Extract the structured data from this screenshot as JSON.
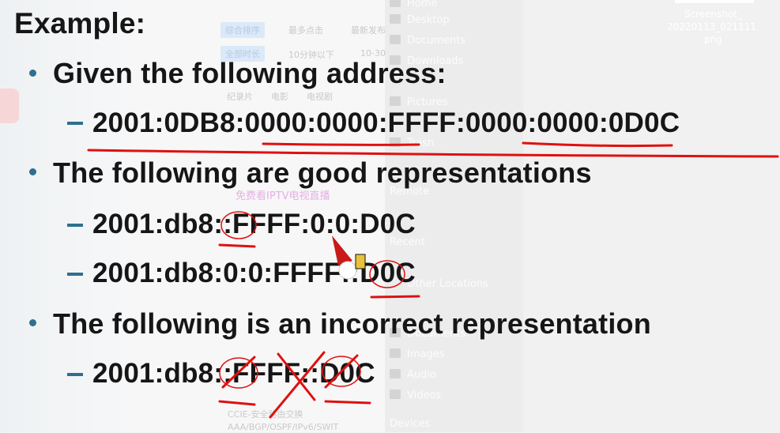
{
  "background": {
    "files_sidebar": [
      "Home",
      "Desktop",
      "Documents",
      "Downloads",
      "Pictures",
      "Trash",
      "Remote",
      "Recent",
      "Other Locations",
      "Documents",
      "Images",
      "Audio",
      "Videos",
      "Devices"
    ],
    "screenshot_file": {
      "name_line1": "Screenshot_",
      "name_line2": "20220113_021111.",
      "name_line3": "png"
    },
    "web_tabs": {
      "tab1": "综合排序",
      "tab2": "最多点击",
      "tab3": "最新发布",
      "filter1": "全部时长",
      "filter2": "10分钟以下",
      "filter3": "10-30",
      "cat1": "纪录片",
      "cat2": "电影",
      "cat3": "电视剧"
    },
    "promo_text": "免费看IPTV电视直播",
    "footer_line1": "CCIE-安全路由交换",
    "footer_line2": "AAA/BGP/OSPF/IPv6/SWIT"
  },
  "slide": {
    "heading": "Example:",
    "b1": "Given the following address:",
    "addr_full": "2001:0DB8:0000:0000:FFFF:0000:0000:0D0C",
    "b2": "The following are good representations",
    "good1": "2001:db8::FFFF:0:0:D0C",
    "good2": "2001:db8:0:0:FFFF::D0C",
    "b3": "The following is an incorrect representation",
    "bad1": "2001:db8::FFFF::D0C"
  },
  "colors": {
    "annotation_red": "#e01010",
    "bullet_blue": "#2f6f8f",
    "text": "#161616"
  }
}
